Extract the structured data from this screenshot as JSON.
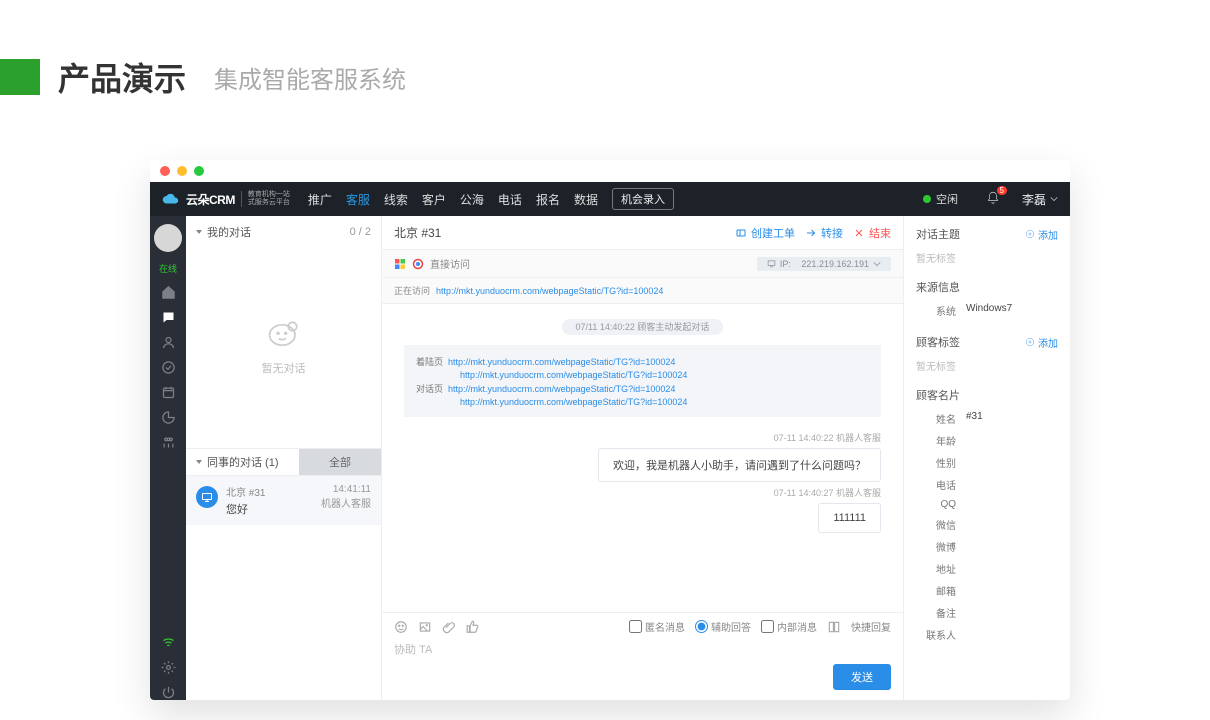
{
  "page_title": {
    "main": "产品演示",
    "sub": "集成智能客服系统"
  },
  "nav": {
    "brand": "云朵CRM",
    "brand_sub1": "教育机构一站",
    "brand_sub2": "式服务云平台",
    "items": [
      "推广",
      "客服",
      "线索",
      "客户",
      "公海",
      "电话",
      "报名",
      "数据"
    ],
    "active_index": 1,
    "record_btn": "机会录入",
    "status": "空闲",
    "notif_count": "5",
    "user": "李磊"
  },
  "rail": {
    "online": "在线"
  },
  "list": {
    "mine": "我的对话",
    "count": "0 / 2",
    "empty": "暂无对话",
    "coll": "同事的对话  (1)",
    "all": "全部",
    "conv": {
      "name": "北京 #31",
      "msg": "您好",
      "time": "14:41:11",
      "agent": "机器人客服"
    }
  },
  "chat": {
    "head_title": "北京 #31",
    "act_create": "创建工单",
    "act_transfer": "转接",
    "act_end": "结束",
    "meta_visit_label": "直接访问",
    "meta_visiting": "正在访问",
    "meta_visit_url": "http://mkt.yunduocrm.com/webpageStatic/TG?id=100024",
    "meta_ip_label": "IP:",
    "meta_ip": "221.219.162.191",
    "sys_pill": "07/11 14:40:22  顾客主动发起对话",
    "ref_landing_label": "着陆页",
    "ref_dialog_label": "对话页",
    "ref_url1": "http://mkt.yunduocrm.com/webpageStatic/TG?id=100024",
    "ref_url2": "http://mkt.yunduocrm.com/webpageStatic/TG?id=100024",
    "ref_url3": "http://mkt.yunduocrm.com/webpageStatic/TG?id=100024",
    "ref_url4": "http://mkt.yunduocrm.com/webpageStatic/TG?id=100024",
    "m1_meta": "07-11 14:40:22  机器人客服",
    "m1_text": "欢迎，我是机器人小助手，请问遇到了什么问题吗？",
    "m2_meta": "07-11 14:40:27  机器人客服",
    "m2_text": "111111",
    "opt_anon": "匿名消息",
    "opt_assist": "辅助回答",
    "opt_internal": "内部消息",
    "opt_quick": "快捷回复",
    "compose_placeholder": "协助 TA",
    "send": "发送"
  },
  "info": {
    "topic": "对话主题",
    "add": "添加",
    "no_tag": "暂无标签",
    "source_title": "来源信息",
    "source_sys_k": "系统",
    "source_sys_v": "Windows7",
    "tags_title": "顾客标签",
    "card_title": "顾客名片",
    "card": {
      "name_k": "姓名",
      "name_v": "#31",
      "age_k": "年龄",
      "gender_k": "性别",
      "phone_k": "电话",
      "qq_k": "QQ",
      "wechat_k": "微信",
      "weibo_k": "微博",
      "addr_k": "地址",
      "email_k": "邮箱",
      "note_k": "备注",
      "contact_k": "联系人"
    }
  }
}
